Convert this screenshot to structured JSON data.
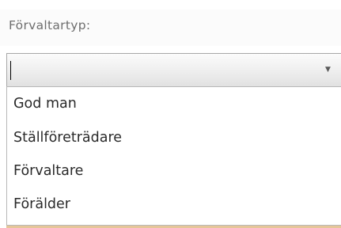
{
  "field": {
    "label": "Förvaltartyp:",
    "value": ""
  },
  "options": [
    "God man",
    "Ställföreträdare",
    "Förvaltare",
    "Förälder"
  ]
}
